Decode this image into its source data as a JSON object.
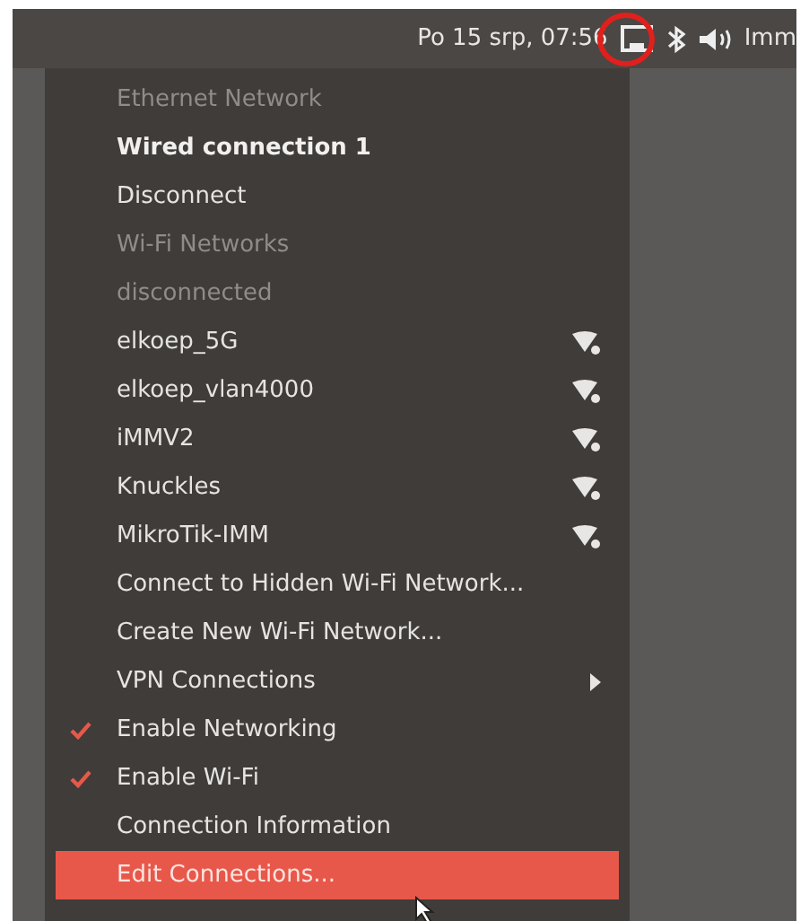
{
  "panel": {
    "clock": "Po 15 srp, 07:56",
    "label_cut": "Imm"
  },
  "menu": {
    "items": [
      {
        "kind": "header",
        "label": "Ethernet Network"
      },
      {
        "kind": "connection",
        "label": "Wired connection 1"
      },
      {
        "kind": "item",
        "label": "Disconnect",
        "selected": false
      },
      {
        "kind": "header",
        "label": "Wi-Fi Networks"
      },
      {
        "kind": "header",
        "label": "disconnected"
      },
      {
        "kind": "network",
        "label": "elkoep_5G",
        "selected": false
      },
      {
        "kind": "network",
        "label": "elkoep_vlan4000",
        "selected": false
      },
      {
        "kind": "network",
        "label": "iMMV2",
        "selected": false
      },
      {
        "kind": "network",
        "label": "Knuckles",
        "selected": false
      },
      {
        "kind": "network",
        "label": "MikroTik-IMM",
        "selected": false
      },
      {
        "kind": "item",
        "label": "Connect to Hidden Wi-Fi Network...",
        "selected": false
      },
      {
        "kind": "item",
        "label": "Create New Wi-Fi Network...",
        "selected": false
      },
      {
        "kind": "submenu",
        "label": "VPN Connections",
        "selected": false
      },
      {
        "kind": "check",
        "label": "Enable Networking",
        "checked": true,
        "selected": false
      },
      {
        "kind": "check",
        "label": "Enable Wi-Fi",
        "checked": true,
        "selected": false
      },
      {
        "kind": "item",
        "label": "Connection Information",
        "selected": false
      },
      {
        "kind": "item",
        "label": "Edit Connections...",
        "selected": true
      }
    ]
  }
}
